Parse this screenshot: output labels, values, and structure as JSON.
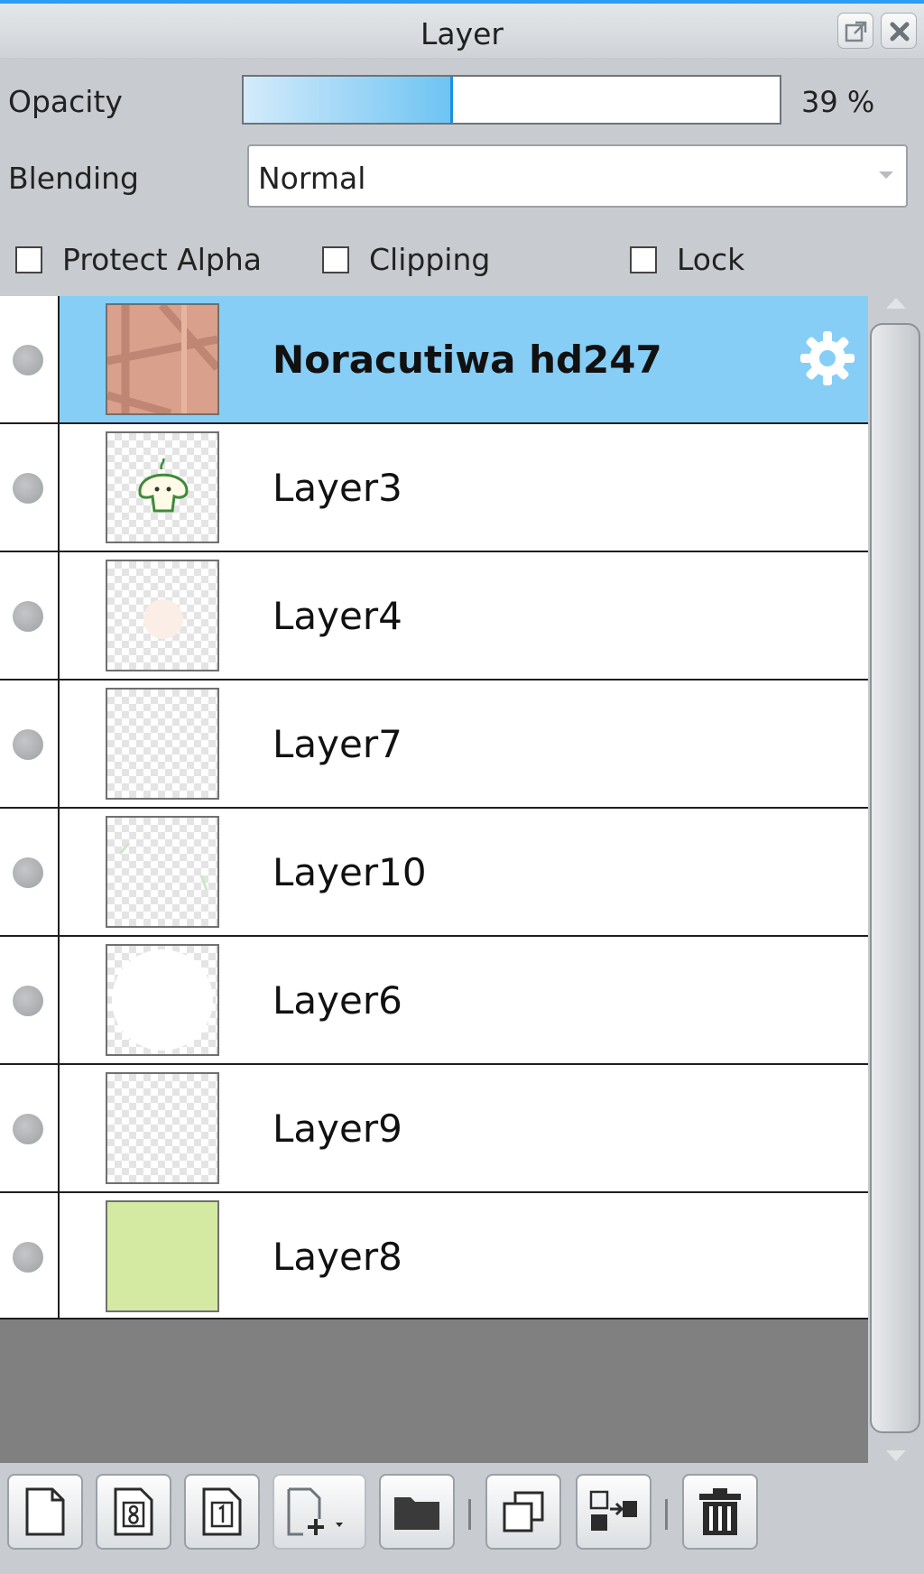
{
  "panel": {
    "title": "Layer",
    "opacity": {
      "label": "Opacity",
      "value_text": "39 %",
      "value_fraction": 0.39
    },
    "blending": {
      "label": "Blending",
      "value": "Normal"
    },
    "checkboxes": {
      "protect_alpha": {
        "label": "Protect Alpha",
        "checked": false
      },
      "clipping": {
        "label": "Clipping",
        "checked": false
      },
      "lock": {
        "label": "Lock",
        "checked": false
      }
    }
  },
  "layers": [
    {
      "name": "Noracutiwa hd247",
      "selected": true,
      "thumbnail": "beige-pattern"
    },
    {
      "name": "Layer3",
      "selected": false,
      "thumbnail": "mushroom-sketch"
    },
    {
      "name": "Layer4",
      "selected": false,
      "thumbnail": "faint-circle"
    },
    {
      "name": "Layer7",
      "selected": false,
      "thumbnail": "transparent"
    },
    {
      "name": "Layer10",
      "selected": false,
      "thumbnail": "transparent"
    },
    {
      "name": "Layer6",
      "selected": false,
      "thumbnail": "white-circle"
    },
    {
      "name": "Layer9",
      "selected": false,
      "thumbnail": "transparent"
    },
    {
      "name": "Layer8",
      "selected": false,
      "thumbnail": "green-fill"
    }
  ],
  "toolbar": {
    "buttons": [
      "new-layer-icon",
      "new-8bit-layer-icon",
      "new-1bit-layer-icon",
      "add-layer-dropdown-icon",
      "folder-icon",
      "duplicate-icon",
      "merge-down-icon",
      "trash-icon"
    ]
  },
  "colors": {
    "accent": "#2a9df4",
    "selected_row": "#86cef6",
    "layer8_fill": "#d4eaa3",
    "thumbnail_pattern": "#d9a08c"
  }
}
